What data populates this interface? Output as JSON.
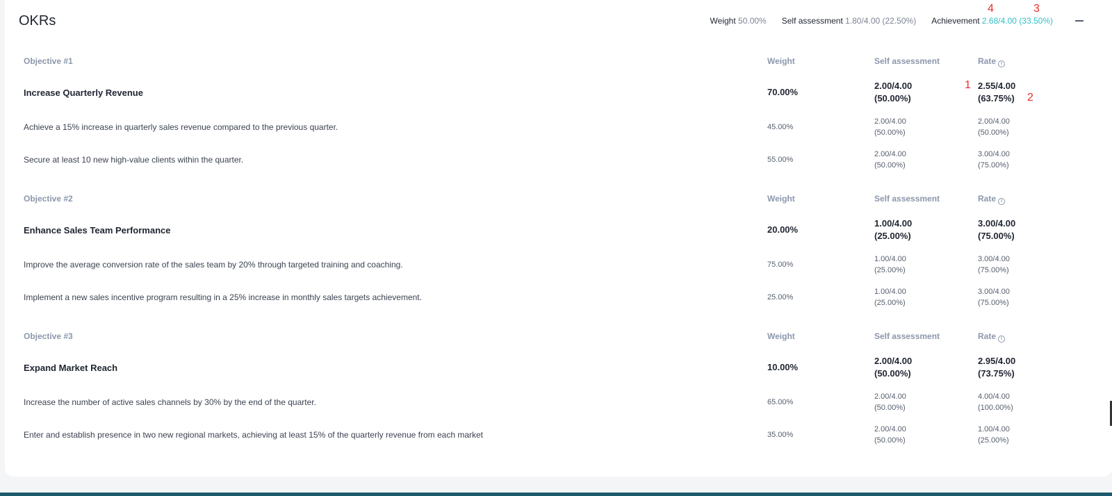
{
  "header": {
    "title": "OKRs",
    "weight_label": "Weight",
    "weight_value": "50.00%",
    "self_label": "Self assessment",
    "self_value": "1.80/4.00 (22.50%)",
    "achievement_label": "Achievement",
    "achievement_value": "2.68/4.00 (33.50%)",
    "accent_color": "#2fbfc9"
  },
  "markers": [
    "1",
    "2",
    "3",
    "4"
  ],
  "columns": {
    "weight": "Weight",
    "self": "Self assessment",
    "rate": "Rate",
    "rate_icon": "info-icon"
  },
  "objectives": [
    {
      "label": "Objective #1",
      "title": "Increase Quarterly Revenue",
      "weight": "70.00%",
      "self_1": "2.00/4.00",
      "self_2": "(50.00%)",
      "rate_1": "2.55/4.00",
      "rate_2": "(63.75%)",
      "krs": [
        {
          "text": "Achieve a 15% increase in quarterly sales revenue compared to the previous quarter.",
          "weight": "45.00%",
          "self_1": "2.00/4.00",
          "self_2": "(50.00%)",
          "rate_1": "2.00/4.00",
          "rate_2": "(50.00%)"
        },
        {
          "text": "Secure at least 10 new high-value clients within the quarter.",
          "weight": "55.00%",
          "self_1": "2.00/4.00",
          "self_2": "(50.00%)",
          "rate_1": "3.00/4.00",
          "rate_2": "(75.00%)"
        }
      ]
    },
    {
      "label": "Objective #2",
      "title": "Enhance Sales Team Performance",
      "weight": "20.00%",
      "self_1": "1.00/4.00",
      "self_2": "(25.00%)",
      "rate_1": "3.00/4.00",
      "rate_2": "(75.00%)",
      "krs": [
        {
          "text": "Improve the average conversion rate of the sales team by 20% through targeted training and coaching.",
          "weight": "75.00%",
          "self_1": "1.00/4.00",
          "self_2": "(25.00%)",
          "rate_1": "3.00/4.00",
          "rate_2": "(75.00%)"
        },
        {
          "text": "Implement a new sales incentive program resulting in a 25% increase in monthly sales targets achievement.",
          "weight": "25.00%",
          "self_1": "1.00/4.00",
          "self_2": "(25.00%)",
          "rate_1": "3.00/4.00",
          "rate_2": "(75.00%)"
        }
      ]
    },
    {
      "label": "Objective #3",
      "title": "Expand Market Reach",
      "weight": "10.00%",
      "self_1": "2.00/4.00",
      "self_2": "(50.00%)",
      "rate_1": "2.95/4.00",
      "rate_2": "(73.75%)",
      "krs": [
        {
          "text": "Increase the number of active sales channels by 30% by the end of the quarter.",
          "weight": "65.00%",
          "self_1": "2.00/4.00",
          "self_2": "(50.00%)",
          "rate_1": "4.00/4.00",
          "rate_2": "(100.00%)"
        },
        {
          "text": "Enter and establish presence in two new regional markets, achieving at least 15% of the quarterly revenue from each market",
          "weight": "35.00%",
          "self_1": "2.00/4.00",
          "self_2": "(50.00%)",
          "rate_1": "1.00/4.00",
          "rate_2": "(25.00%)"
        }
      ]
    }
  ]
}
